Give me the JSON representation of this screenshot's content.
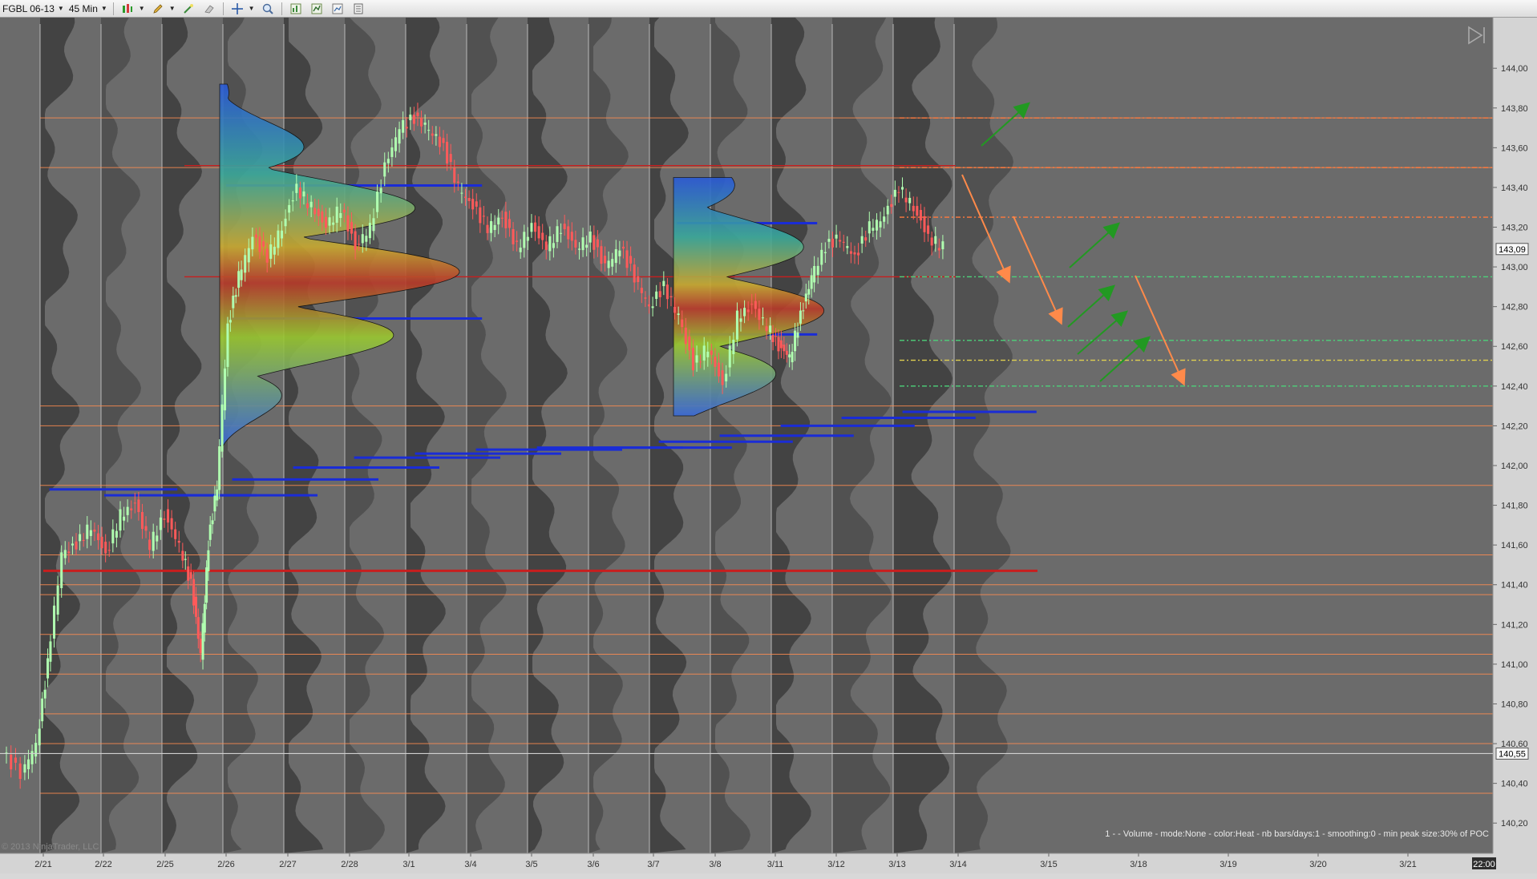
{
  "toolbar": {
    "instrument": "FGBL 06-13",
    "interval": "45 Min",
    "icons": [
      "chart-style-icon",
      "draw-pencil-icon",
      "wand-icon",
      "eraser-icon",
      "crosshair-icon",
      "zoom-icon",
      "indicators-icon",
      "strategy-icon",
      "data-box-icon",
      "properties-icon"
    ]
  },
  "chart_data": {
    "type": "candlestick",
    "ylim": [
      140.1,
      144.15
    ],
    "y_ticks": [
      144.0,
      143.8,
      143.6,
      143.4,
      143.2,
      143.0,
      142.8,
      142.6,
      142.4,
      142.2,
      142.0,
      141.8,
      141.6,
      141.4,
      141.2,
      141.0,
      140.8,
      140.6,
      140.4,
      140.2
    ],
    "y_tick_labels": [
      "144,00",
      "143,80",
      "143,60",
      "143,40",
      "143,20",
      "143,00",
      "142,80",
      "142,60",
      "142,40",
      "142,20",
      "142,00",
      "141,80",
      "141,60",
      "141,40",
      "141,20",
      "141,00",
      "140,80",
      "140,60",
      "140,40",
      "140,20"
    ],
    "x_labels": [
      "2/21",
      "2/22",
      "2/25",
      "2/26",
      "2/27",
      "2/28",
      "3/1",
      "3/4",
      "3/5",
      "3/6",
      "3/7",
      "3/8",
      "3/11",
      "3/12",
      "3/13",
      "3/14",
      "3/15",
      "3/18",
      "3/19",
      "3/20",
      "3/21"
    ],
    "time_label": "22:00",
    "last_price": 143.09,
    "last_price_label": "143,09",
    "crosshair_price": 140.55,
    "crosshair_price_label": "140,55",
    "price_path": [
      [
        0,
        140.55
      ],
      [
        0.5,
        140.45
      ],
      [
        0.9,
        140.6
      ],
      [
        1.2,
        141.0
      ],
      [
        1.6,
        141.55
      ],
      [
        2.0,
        141.6
      ],
      [
        2.4,
        141.7
      ],
      [
        2.8,
        141.55
      ],
      [
        3.2,
        141.75
      ],
      [
        3.6,
        141.8
      ],
      [
        4.0,
        141.6
      ],
      [
        4.4,
        141.75
      ],
      [
        4.8,
        141.6
      ],
      [
        5.1,
        141.4
      ],
      [
        5.35,
        141.05
      ],
      [
        5.55,
        141.6
      ],
      [
        5.8,
        141.9
      ],
      [
        6.1,
        142.7
      ],
      [
        6.4,
        142.95
      ],
      [
        6.8,
        143.15
      ],
      [
        7.2,
        143.05
      ],
      [
        7.6,
        143.2
      ],
      [
        8.0,
        143.4
      ],
      [
        8.4,
        143.3
      ],
      [
        8.8,
        143.2
      ],
      [
        9.2,
        143.3
      ],
      [
        9.6,
        143.1
      ],
      [
        10.0,
        143.2
      ],
      [
        10.4,
        143.5
      ],
      [
        10.8,
        143.7
      ],
      [
        11.2,
        143.75
      ],
      [
        11.6,
        143.7
      ],
      [
        12.0,
        143.6
      ],
      [
        12.4,
        143.4
      ],
      [
        12.8,
        143.3
      ],
      [
        13.2,
        143.2
      ],
      [
        13.6,
        143.25
      ],
      [
        14.0,
        143.1
      ],
      [
        14.4,
        143.2
      ],
      [
        14.8,
        143.1
      ],
      [
        15.2,
        143.2
      ],
      [
        15.6,
        143.1
      ],
      [
        16.0,
        143.15
      ],
      [
        16.4,
        143.0
      ],
      [
        16.8,
        143.1
      ],
      [
        17.2,
        142.95
      ],
      [
        17.6,
        142.8
      ],
      [
        18.0,
        142.9
      ],
      [
        18.4,
        142.75
      ],
      [
        18.8,
        142.5
      ],
      [
        19.2,
        142.6
      ],
      [
        19.6,
        142.4
      ],
      [
        20.0,
        142.75
      ],
      [
        20.4,
        142.8
      ],
      [
        20.8,
        142.7
      ],
      [
        21.1,
        142.6
      ],
      [
        21.4,
        142.55
      ],
      [
        21.7,
        142.75
      ],
      [
        22.0,
        142.95
      ],
      [
        22.4,
        143.1
      ],
      [
        22.8,
        143.15
      ],
      [
        23.2,
        143.05
      ],
      [
        23.6,
        143.2
      ],
      [
        24.0,
        143.25
      ],
      [
        24.4,
        143.4
      ],
      [
        24.8,
        143.3
      ],
      [
        25.2,
        143.15
      ],
      [
        25.6,
        143.1
      ]
    ],
    "orange_levels": [
      143.75,
      143.5,
      142.3,
      142.2,
      141.9,
      141.55,
      141.4,
      141.35,
      141.15,
      141.05,
      140.95,
      140.75,
      140.6,
      140.35
    ],
    "red_levels": [
      143.51,
      142.95,
      141.47
    ],
    "dotted_levels": [
      {
        "price": 143.75,
        "color": "#ff7a3d"
      },
      {
        "price": 143.5,
        "color": "#ff7a3d"
      },
      {
        "price": 143.25,
        "color": "#ff7a3d"
      },
      {
        "price": 142.95,
        "color": "#4cd27a"
      },
      {
        "price": 142.63,
        "color": "#4cd27a"
      },
      {
        "price": 142.53,
        "color": "#e0d050"
      },
      {
        "price": 142.4,
        "color": "#4cd27a"
      }
    ],
    "blue_levels": [
      {
        "x0": 0.1,
        "x1": 2.2,
        "price": 141.88
      },
      {
        "x0": 1.0,
        "x1": 3.5,
        "price": 141.85
      },
      {
        "x0": 2.0,
        "x1": 4.5,
        "price": 141.85
      },
      {
        "x0": 3.1,
        "x1": 5.5,
        "price": 141.93
      },
      {
        "x0": 4.1,
        "x1": 6.5,
        "price": 141.99
      },
      {
        "x0": 5.1,
        "x1": 7.5,
        "price": 142.04
      },
      {
        "x0": 6.1,
        "x1": 8.5,
        "price": 142.06
      },
      {
        "x0": 7.1,
        "x1": 9.5,
        "price": 142.08
      },
      {
        "x0": 8.1,
        "x1": 10.5,
        "price": 142.09
      },
      {
        "x0": 9.1,
        "x1": 11.3,
        "price": 142.09
      },
      {
        "x0": 10.1,
        "x1": 12.3,
        "price": 142.12
      },
      {
        "x0": 11.1,
        "x1": 13.3,
        "price": 142.15
      },
      {
        "x0": 12.1,
        "x1": 14.3,
        "price": 142.2
      },
      {
        "x0": 13.1,
        "x1": 15.3,
        "price": 142.24
      },
      {
        "x0": 14.1,
        "x1": 16.3,
        "price": 142.27
      },
      {
        "x0": 3.0,
        "x1": 7.2,
        "price": 143.41
      },
      {
        "x0": 3.0,
        "x1": 7.2,
        "price": 142.74
      },
      {
        "x0": 10.4,
        "x1": 12.7,
        "price": 143.22
      },
      {
        "x0": 10.4,
        "x1": 12.7,
        "price": 142.66
      }
    ],
    "annotation": "1 -   - Volume - mode:None  - color:Heat - nb bars/days:1 - smoothing:0 - min peak size:30% of POC",
    "copyright": "© 2013 NinjaTrader, LLC"
  },
  "colors": {
    "background": "#6b6b6b",
    "profile": "#4f4f4f",
    "profile_dark": "#3f3f3f",
    "session_line": "#bdbdbd",
    "orange": "#ff8c50",
    "red": "#c81e1e",
    "blue": "#1a2cd6",
    "candle_up": "#b0ffb0",
    "candle_down": "#ff5a5a",
    "arrow_orange": "#ff8a4a",
    "arrow_green": "#229922"
  }
}
